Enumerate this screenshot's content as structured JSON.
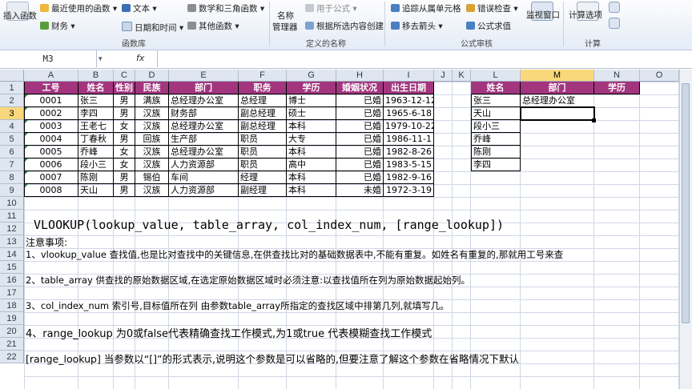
{
  "ribbon": {
    "insert_function": "插入函数",
    "recent": "最近使用的函数 ▾",
    "financial": "财务 ▾",
    "text": "文本 ▾",
    "datetime": "日期和时间 ▾",
    "math": "数学和三角函数 ▾",
    "other": "其他函数 ▾",
    "group_library": "函数库",
    "name_label": "名称",
    "name_manager": "管理器",
    "use_in_formula": "用于公式 ▾",
    "create_from_sel": "根据所选内容创建",
    "group_names": "定义的名称",
    "trace_dep": "追踪从属单元格",
    "remove_arrows": "移去箭头 ▾",
    "error_check": "错误检查 ▾",
    "eval_formula": "公式求值",
    "group_audit": "公式审核",
    "watch": "监视窗口",
    "calc_options": "计算选项",
    "group_calc": "计算"
  },
  "formula_bar": {
    "name_box": "M3",
    "fx": "fx",
    "content": ""
  },
  "columns": [
    "A",
    "B",
    "C",
    "D",
    "E",
    "F",
    "G",
    "H",
    "I",
    "J",
    "K",
    "L",
    "M",
    "N",
    "O"
  ],
  "rows": [
    "1",
    "2",
    "3",
    "4",
    "5",
    "6",
    "7",
    "8",
    "9",
    "10",
    "11",
    "12",
    "13",
    "14",
    "15",
    "16",
    "17",
    "18",
    "19",
    "20",
    "21",
    "22"
  ],
  "table": {
    "headers": [
      "工号",
      "姓名",
      "性别",
      "民族",
      "部门",
      "职务",
      "学历",
      "婚姻状况",
      "出生日期"
    ],
    "rows": [
      [
        "0001",
        "张三",
        "男",
        "满族",
        "总经理办公室",
        "总经理",
        "博士",
        "已婚",
        "1963-12-12"
      ],
      [
        "0002",
        "李四",
        "男",
        "汉族",
        "财务部",
        "副总经理",
        "硕士",
        "已婚",
        "1965-6-18"
      ],
      [
        "0003",
        "王老七",
        "女",
        "汉族",
        "总经理办公室",
        "副总经理",
        "本科",
        "已婚",
        "1979-10-22"
      ],
      [
        "0004",
        "丁春秋",
        "男",
        "回族",
        "生产部",
        "职员",
        "大专",
        "已婚",
        "1986-11-1"
      ],
      [
        "0005",
        "乔峰",
        "女",
        "汉族",
        "总经理办公室",
        "职员",
        "本科",
        "已婚",
        "1982-8-26"
      ],
      [
        "0006",
        "段小三",
        "女",
        "汉族",
        "人力资源部",
        "职员",
        "高中",
        "已婚",
        "1983-5-15"
      ],
      [
        "0007",
        "陈刚",
        "男",
        "锡伯",
        "车间",
        "经理",
        "本科",
        "已婚",
        "1982-9-16"
      ],
      [
        "0008",
        "天山",
        "男",
        "汉族",
        "人力资源部",
        "副经理",
        "本科",
        "未婚",
        "1972-3-19"
      ]
    ]
  },
  "lookup": {
    "headers": [
      "姓名",
      "部门",
      "学历"
    ],
    "names": [
      "张三",
      "天山",
      "段小三",
      "乔峰",
      "陈刚",
      "李四"
    ],
    "dept_first": "总经理办公室"
  },
  "notes": {
    "syntax": "VLOOKUP(lookup_value, table_array, col_index_num, [range_lookup])",
    "title": "注意事项:",
    "n1": "1、vlookup_value 查找值,也是比对查找中的关键信息,在供查找比对的基础数据表中,不能有重复。如姓名有重复的,那就用工号来查",
    "n2": "2、table_array 供查找的原始数据区域,在选定原始数据区域时必须注意:以查找值所在列为原始数据起始列。",
    "n3": "3、col_index_num 索引号,目标值所在列 由参数table_array所指定的查找区域中排第几列,就填写几。",
    "n4": "4、range_lookup  为0或false代表精确查找工作模式,为1或true 代表模糊查找工作模式",
    "n5": "[range_lookup]  当参数以“[]”的形式表示,说明这个参数是可以省略的,但要注意了解这个参数在省略情况下默认"
  },
  "colors": {
    "header_bg": "#a3357f",
    "selected_header": "#f9d87c",
    "grid": "#d0d7e5"
  }
}
